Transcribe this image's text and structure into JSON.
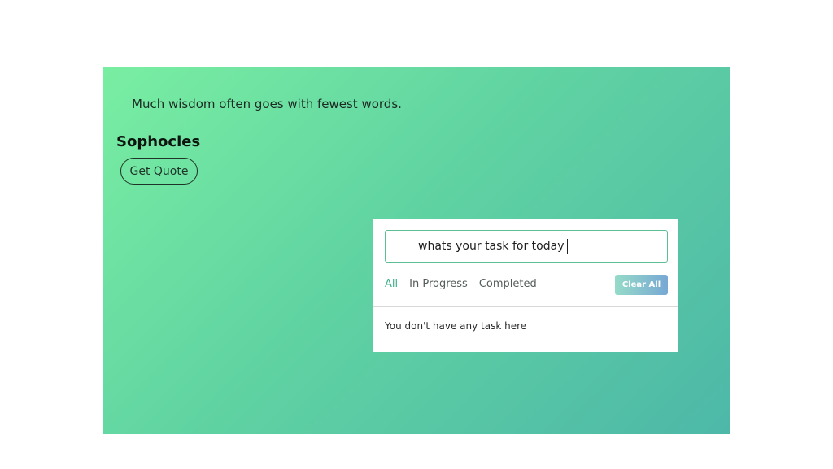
{
  "quote": {
    "text": "Much wisdom often goes with fewest words.",
    "author": "Sophocles",
    "button_label": "Get Quote"
  },
  "todo": {
    "input_value": "whats your task for today",
    "filters": [
      "All",
      "In Progress",
      "Completed"
    ],
    "active_filter": "All",
    "clear_label": "Clear All",
    "empty_message": "You don't have any task here"
  },
  "colors": {
    "background_gradient_start": "#79eea2",
    "background_gradient_end": "#4db8a8",
    "accent": "#3fb08a",
    "clear_button_start": "#95dbc8",
    "clear_button_end": "#78a8d4"
  }
}
